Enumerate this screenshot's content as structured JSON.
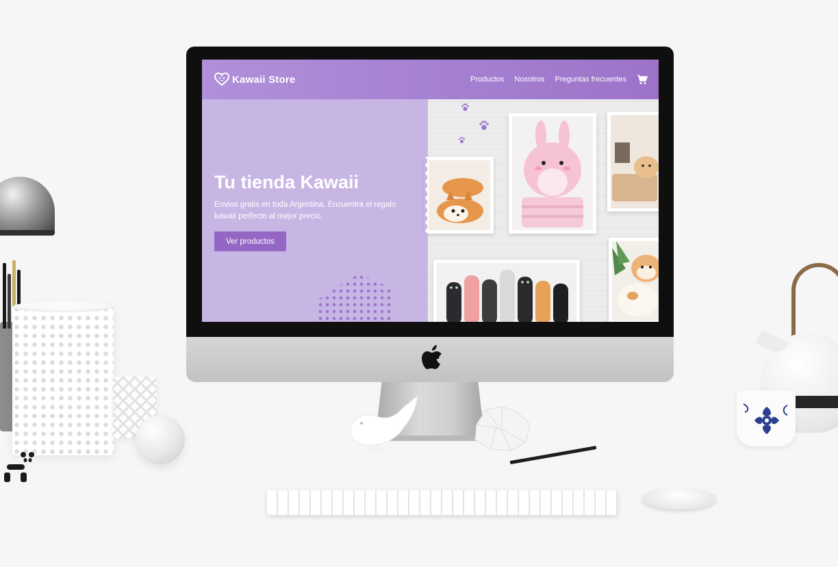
{
  "site": {
    "brand": "Kawaii Store",
    "nav": {
      "products": "Productos",
      "about": "Nosotros",
      "faq": "Preguntas frecuentes"
    },
    "hero": {
      "title": "Tu tienda Kawaii",
      "subtitle": "Envios gratis en toda Argentina. Encuentra el regalo kawaii perfecto al mejor precio.",
      "cta": "Ver productos"
    },
    "product_photos": [
      "corgi-plush",
      "bunny-plush",
      "cat-pillow",
      "cat-long-plush",
      "hamster-plush",
      "shiba-plush"
    ]
  },
  "colors": {
    "header_start": "#b090da",
    "header_end": "#9c73c9",
    "hero_bg": "#c7b5e4",
    "button": "#9467c4",
    "dot_pattern": "#9c74d0"
  }
}
